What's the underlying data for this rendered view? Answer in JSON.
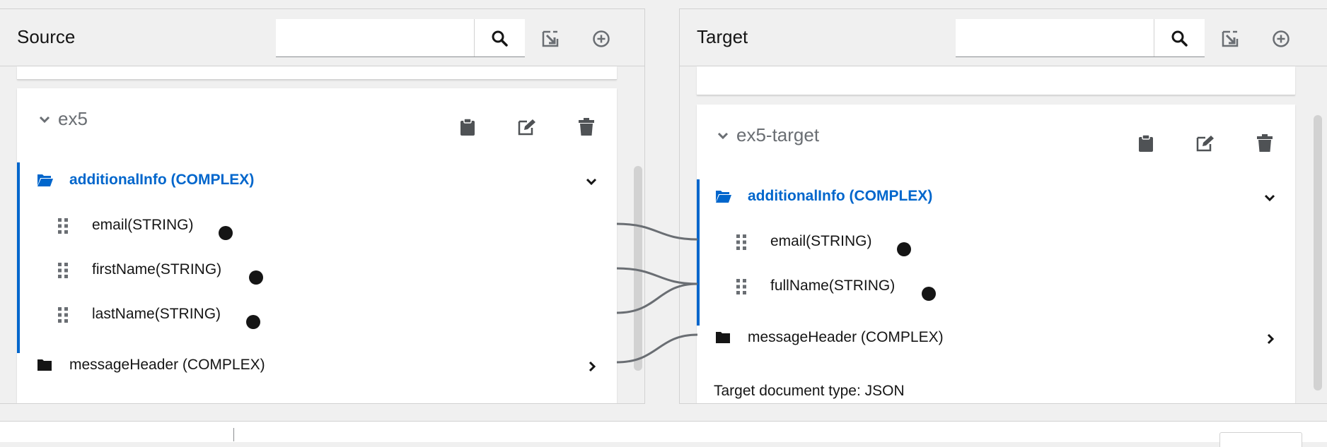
{
  "source": {
    "title": "Source",
    "search": {
      "value": "",
      "placeholder": ""
    },
    "document": {
      "name": "ex5",
      "root": {
        "label": "additionalInfo (COMPLEX)",
        "expanded": true
      },
      "fields": [
        {
          "label": "email(STRING)"
        },
        {
          "label": "firstName(STRING)"
        },
        {
          "label": "lastName(STRING)"
        }
      ],
      "collapsed": {
        "label": "messageHeader (COMPLEX)"
      }
    }
  },
  "target": {
    "title": "Target",
    "search": {
      "value": "",
      "placeholder": ""
    },
    "document": {
      "name": "ex5-target",
      "root": {
        "label": "additionalInfo (COMPLEX)",
        "expanded": true
      },
      "fields": [
        {
          "label": "email(STRING)"
        },
        {
          "label": "fullName(STRING)"
        }
      ],
      "collapsed": {
        "label": "messageHeader (COMPLEX)"
      },
      "doc_type": "Target document type: JSON"
    }
  },
  "icons": {
    "search": "search-icon",
    "import": "import-icon",
    "add": "plus-circle-icon",
    "clipboard": "clipboard-icon",
    "edit": "edit-icon",
    "trash": "trash-icon",
    "folder_open": "folder-open-icon",
    "folder": "folder-icon",
    "grip": "grip-icon"
  },
  "colors": {
    "accent": "#0066cc",
    "text": "#151515",
    "muted": "#6a6e73",
    "line": "#6a6e73"
  }
}
